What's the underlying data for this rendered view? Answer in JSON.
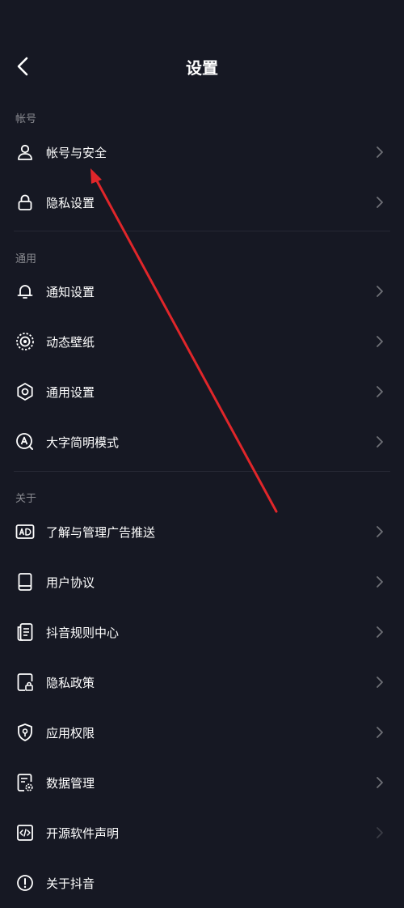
{
  "header": {
    "title": "设置",
    "back_icon": "chevron-left-icon"
  },
  "sections": [
    {
      "label": "帐号",
      "items": [
        {
          "label": "帐号与安全",
          "icon": "user-icon"
        },
        {
          "label": "隐私设置",
          "icon": "lock-icon"
        }
      ]
    },
    {
      "label": "通用",
      "items": [
        {
          "label": "通知设置",
          "icon": "bell-icon"
        },
        {
          "label": "动态壁纸",
          "icon": "wallpaper-icon"
        },
        {
          "label": "通用设置",
          "icon": "gear-icon"
        },
        {
          "label": "大字简明模式",
          "icon": "large-font-icon"
        }
      ]
    },
    {
      "label": "关于",
      "items": [
        {
          "label": "了解与管理广告推送",
          "icon": "ad-icon"
        },
        {
          "label": "用户协议",
          "icon": "book-icon"
        },
        {
          "label": "抖音规则中心",
          "icon": "document-list-icon"
        },
        {
          "label": "隐私政策",
          "icon": "privacy-doc-icon"
        },
        {
          "label": "应用权限",
          "icon": "shield-icon"
        },
        {
          "label": "数据管理",
          "icon": "data-manage-icon"
        },
        {
          "label": "开源软件声明",
          "icon": "code-icon"
        },
        {
          "label": "关于抖音",
          "icon": "info-icon"
        }
      ]
    }
  ],
  "colors": {
    "background": "#161823",
    "text": "#ffffff",
    "secondary": "#8a8b91",
    "annotation_arrow": "#e0262a"
  }
}
